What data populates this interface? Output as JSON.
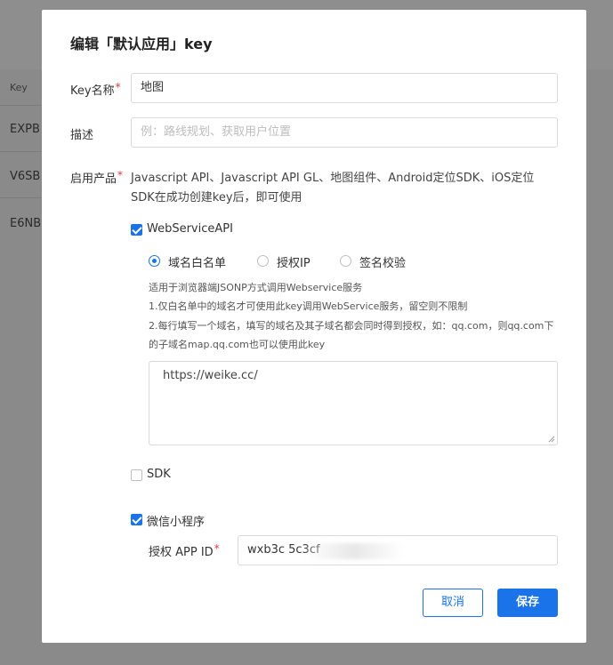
{
  "background": {
    "table_header": "Key",
    "rows": [
      "EXPB",
      "V6SB",
      "E6NB"
    ]
  },
  "modal": {
    "title": "编辑「默认应用」key",
    "key_name": {
      "label": "Key名称",
      "required": "*",
      "value": "地图"
    },
    "description": {
      "label": "描述",
      "placeholder": "例：路线规划、获取用户位置"
    },
    "products": {
      "label": "启用产品",
      "required": "*",
      "text": "Javascript API、Javascript API GL、地图组件、Android定位SDK、iOS定位SDK在成功创建key后，即可使用"
    },
    "webservice": {
      "label": "WebServiceAPI",
      "checked": true,
      "radios": [
        {
          "label": "域名白名单",
          "selected": true
        },
        {
          "label": "授权IP",
          "selected": false
        },
        {
          "label": "签名校验",
          "selected": false
        }
      ],
      "hint1": "适用于浏览器端JSONP方式调用Webservice服务",
      "hint2": "1.仅白名单中的域名才可使用此key调用WebService服务，留空则不限制",
      "hint3": "2.每行填写一个域名，填写的域名及其子域名都会同时得到授权，如：qq.com，则qq.com下的子域名map.qq.com也可以使用此key",
      "textarea_value": "https://weike.cc/"
    },
    "sdk": {
      "label": "SDK",
      "checked": false
    },
    "wechat": {
      "label": "微信小程序",
      "checked": true,
      "appid_label": "授权 APP ID",
      "appid_required": "*",
      "appid_value": "wxb3c            5c3cf"
    },
    "buttons": {
      "cancel": "取消",
      "save": "保存"
    },
    "colors": {
      "accent": "#1a73e8",
      "required": "#e53935"
    }
  }
}
